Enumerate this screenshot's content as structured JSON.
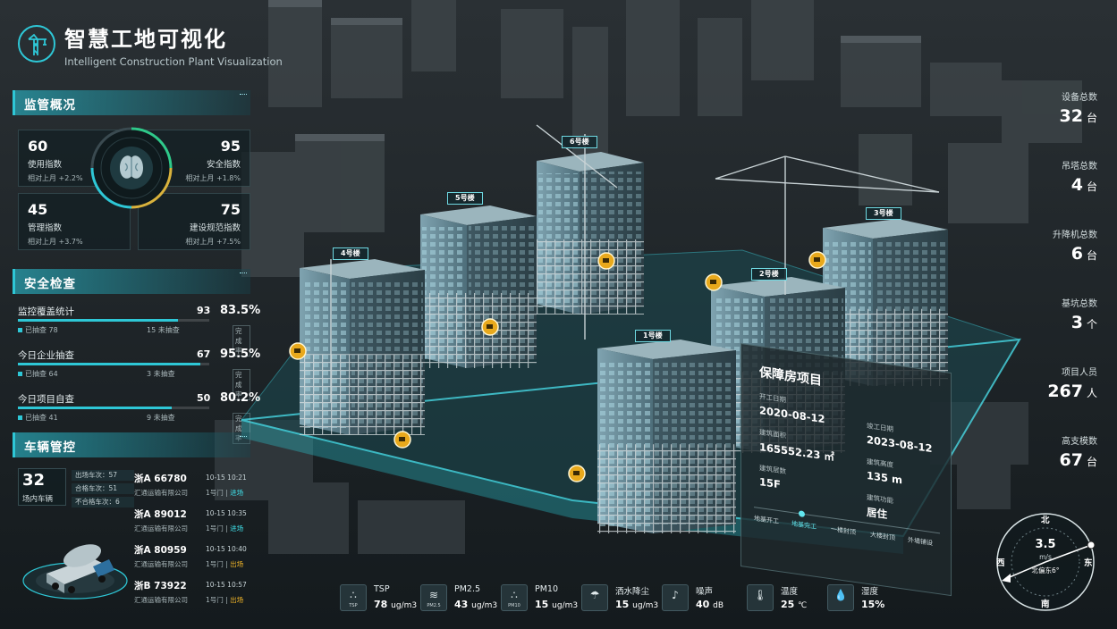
{
  "header": {
    "title_cn": "智慧工地可视化",
    "title_en": "Intelligent Construction Plant Visualization"
  },
  "supervision": {
    "title": "监管概况",
    "indices": [
      {
        "value": "60",
        "label": "使用指数",
        "change": "相对上月 +2.2%"
      },
      {
        "value": "95",
        "label": "安全指数",
        "change": "相对上月 +1.8%"
      },
      {
        "value": "45",
        "label": "管理指数",
        "change": "相对上月 +3.7%"
      },
      {
        "value": "75",
        "label": "建设规范指数",
        "change": "相对上月 +7.5%"
      }
    ]
  },
  "safety": {
    "title": "安全检查",
    "rows": [
      {
        "name": "监控覆盖统计",
        "count": "93",
        "percent": "83.5%",
        "ratio": 0.835,
        "done_label": "已抽查",
        "done": "78",
        "todo": "15",
        "todo_label": "未抽查",
        "rate_label": "完成率"
      },
      {
        "name": "今日企业抽查",
        "count": "67",
        "percent": "95.5%",
        "ratio": 0.955,
        "done_label": "已抽查",
        "done": "64",
        "todo": "3",
        "todo_label": "未抽查",
        "rate_label": "完成率"
      },
      {
        "name": "今日项目自查",
        "count": "50",
        "percent": "80.2%",
        "ratio": 0.802,
        "done_label": "已抽查",
        "done": "41",
        "todo": "9",
        "todo_label": "未抽查",
        "rate_label": "完成率"
      }
    ]
  },
  "vehicles": {
    "title": "车辆管控",
    "count": "32",
    "count_label": "场内车辆",
    "stats": [
      "出场车次：57",
      "合格车次：51",
      "不合格车次：6"
    ],
    "items": [
      {
        "plate": "浙A 66780",
        "time": "10-15 10:21",
        "company": "汇通运输有限公司",
        "gate": "1号门 | ",
        "dir": "进场",
        "dir_type": "in"
      },
      {
        "plate": "浙A 89012",
        "time": "10-15 10:35",
        "company": "汇通运输有限公司",
        "gate": "1号门 | ",
        "dir": "进场",
        "dir_type": "in"
      },
      {
        "plate": "浙A 80959",
        "time": "10-15 10:40",
        "company": "汇通运输有限公司",
        "gate": "1号门 | ",
        "dir": "出场",
        "dir_type": "out"
      },
      {
        "plate": "浙B 73922",
        "time": "10-15 10:57",
        "company": "汇通运输有限公司",
        "gate": "1号门 | ",
        "dir": "出场",
        "dir_type": "out"
      }
    ]
  },
  "right_stats": [
    {
      "label": "设备总数",
      "value": "32",
      "unit": "台"
    },
    {
      "label": "吊塔总数",
      "value": "4",
      "unit": "台"
    },
    {
      "label": "升降机总数",
      "value": "6",
      "unit": "台"
    },
    {
      "label": "基坑总数",
      "value": "3",
      "unit": "个"
    },
    {
      "label": "项目人员",
      "value": "267",
      "unit": "人"
    },
    {
      "label": "高支模数",
      "value": "67",
      "unit": "台"
    }
  ],
  "buildings": [
    "1号楼",
    "2号楼",
    "3号楼",
    "4号楼",
    "5号楼",
    "6号楼"
  ],
  "project": {
    "title": "保障房项目",
    "start_label": "开工日期",
    "start": "2020-08-12",
    "end_label": "竣工日期",
    "end": "2023-08-12",
    "area_label": "建筑面积",
    "area": "165552.23 ㎡",
    "height_label": "建筑高度",
    "height": "135 m",
    "floors_label": "建筑层数",
    "floors": "15F",
    "function_label": "建筑功能",
    "function": "居住",
    "steps": [
      "地基开工",
      "地基完工",
      "一楼封顶",
      "大楼封顶",
      "外墙铺设"
    ]
  },
  "environment": [
    {
      "icon": "TSP",
      "name": "TSP",
      "value": "78",
      "unit": "ug/m3"
    },
    {
      "icon": "PM2.5",
      "name": "PM2.5",
      "value": "43",
      "unit": "ug/m3"
    },
    {
      "icon": "PM10",
      "name": "PM10",
      "value": "15",
      "unit": "ug/m3"
    },
    {
      "icon": "",
      "name": "洒水降尘",
      "value": "15",
      "unit": "ug/m3"
    },
    {
      "icon": "",
      "name": "噪声",
      "value": "40",
      "unit": "dB"
    },
    {
      "icon": "",
      "name": "温度",
      "value": "25",
      "unit": "℃"
    },
    {
      "icon": "",
      "name": "湿度",
      "value": "15%",
      "unit": ""
    }
  ],
  "wind": {
    "north": "北",
    "south": "南",
    "west": "西",
    "east": "东",
    "speed": "3.5",
    "unit": "m/s",
    "direction": "北偏东6°"
  },
  "colors": {
    "accent": "#2ec7d6",
    "in": "#3fe0e9",
    "out": "#f2b628",
    "camera": "#e8a91c"
  }
}
